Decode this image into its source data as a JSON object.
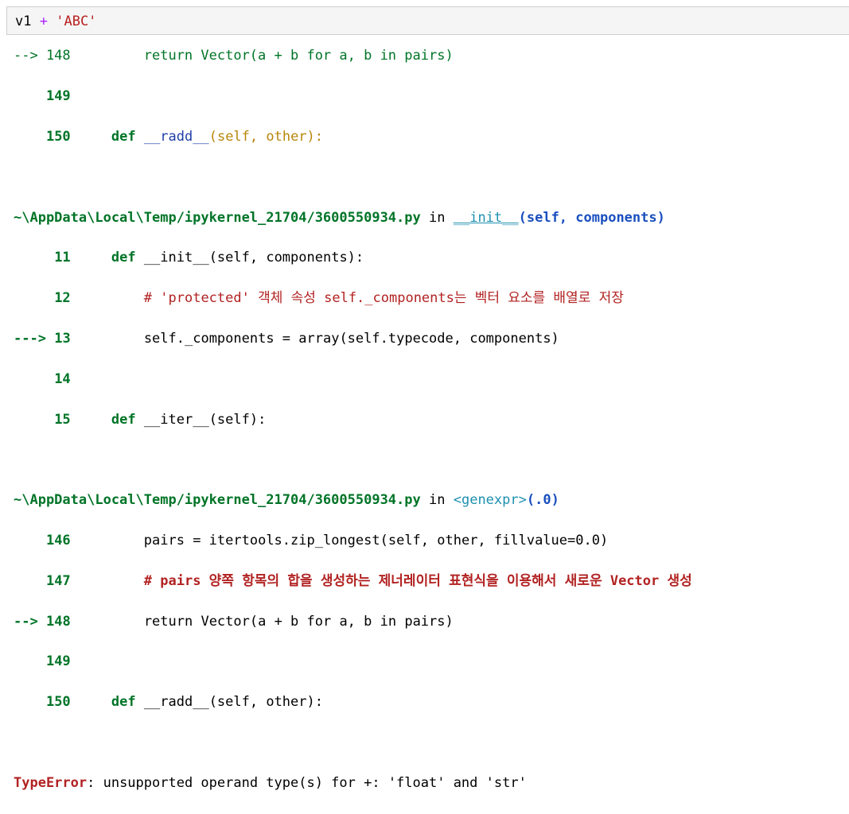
{
  "input_cell": {
    "var": "v1",
    "op": "+",
    "str": "'ABC'"
  },
  "cut_line": "--> 148         return Vector(a + b for a, b in pairs)",
  "block1": {
    "l149": "149",
    "l150": "150",
    "l150_code_kw": "def",
    "l150_code_name": "__radd__",
    "l150_code_rest": "(self, other):"
  },
  "frame1": {
    "path": "~\\AppData\\Local\\Temp/ipykernel_21704/3600550934.py",
    "in": "in",
    "func": "__init__",
    "args": "(self, components)",
    "lines": [
      {
        "num": "11",
        "arrow": "",
        "kw": "def",
        "code": " __init__(self, components):"
      },
      {
        "num": "12",
        "arrow": "",
        "comment": "# 'protected' 객체 속성 self._components는 벡터 요소를 배열로 저장"
      },
      {
        "num": "13",
        "arrow": "--->",
        "code": "self._components = array(self.typecode, components)"
      },
      {
        "num": "14",
        "arrow": ""
      },
      {
        "num": "15",
        "arrow": "",
        "kw": "def",
        "code": " __iter__(self):"
      }
    ]
  },
  "frame2": {
    "path": "~\\AppData\\Local\\Temp/ipykernel_21704/3600550934.py",
    "in": "in",
    "func": "<genexpr>",
    "args": "(.0)",
    "lines": [
      {
        "num": "146",
        "code": "pairs = itertools.zip_longest(self, other, fillvalue=0.0)"
      },
      {
        "num": "147",
        "comment": "# pairs 양쪽 항목의 합을 생성하는 제너레이터 표현식을 이용해서 새로운 Vector 생성"
      },
      {
        "num": "148",
        "arrow": "-->",
        "code": "return Vector(a + b for a, b in pairs)"
      },
      {
        "num": "149"
      },
      {
        "num": "150",
        "kw": "def",
        "code": " __radd__(self, other):"
      }
    ]
  },
  "error": {
    "type": "TypeError",
    "message": ": unsupported operand type(s) for +: 'float' and 'str'"
  }
}
